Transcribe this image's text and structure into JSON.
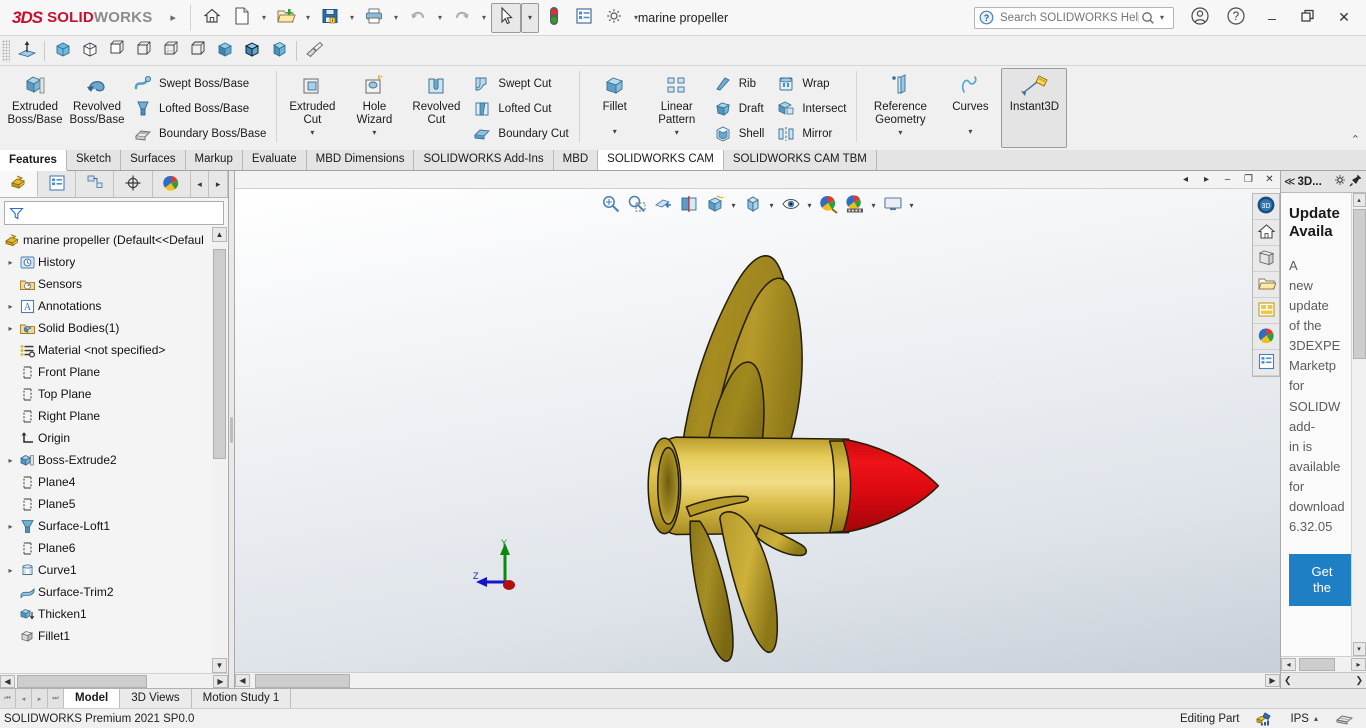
{
  "titlebar": {
    "logo_ds": "3DS",
    "logo_solid": "SOLID",
    "logo_works": "WORKS",
    "expand_label": "▸",
    "document_title": "marine propeller",
    "buttons": [
      {
        "name": "home-icon",
        "label": "Home"
      },
      {
        "name": "new-document-icon",
        "label": "New"
      },
      {
        "name": "open-document-icon",
        "label": "Open"
      },
      {
        "name": "save-icon",
        "label": "Save"
      },
      {
        "name": "print-icon",
        "label": "Print"
      },
      {
        "name": "undo-icon",
        "label": "Undo"
      },
      {
        "name": "redo-icon",
        "label": "Redo"
      },
      {
        "name": "select-cursor-icon",
        "label": "Select"
      },
      {
        "name": "rebuild-icon",
        "label": "Rebuild"
      },
      {
        "name": "options-list-icon",
        "label": "File Properties"
      },
      {
        "name": "gear-icon",
        "label": "Options"
      }
    ],
    "search_placeholder": "Search SOLIDWORKS Help",
    "search_value": "",
    "account_label": "Account",
    "help_label": "Help",
    "minimize_label": "–",
    "restore_label": "❐",
    "close_label": "✕"
  },
  "reference_toolbar": {
    "items": [
      {
        "name": "reference-plane-icon",
        "label": "Plane"
      },
      {
        "name": "iso-view-icon",
        "label": "Isometric"
      },
      {
        "name": "trimetric-view-icon",
        "label": "Trimetric"
      },
      {
        "name": "dimetric-view-icon",
        "label": "Dimetric"
      },
      {
        "name": "wireframe-box-icon",
        "label": "Wireframe"
      },
      {
        "name": "hidden-lines-box-icon",
        "label": "Hidden Lines Visible"
      },
      {
        "name": "hidden-removed-box-icon",
        "label": "Hidden Lines Removed"
      },
      {
        "name": "shaded-box-icon",
        "label": "Shaded"
      },
      {
        "name": "shaded-edges-box-icon",
        "label": "Shaded With Edges"
      },
      {
        "name": "perspective-box-icon",
        "label": "Perspective"
      },
      {
        "name": "section-view-icon",
        "label": "Section View"
      }
    ]
  },
  "ribbon": {
    "groups": [
      {
        "name": "boss-base-group",
        "big": [
          {
            "name": "extruded-boss-base-button",
            "icon": "extrude-boss-icon",
            "line1": "Extruded",
            "line2": "Boss/Base"
          },
          {
            "name": "revolved-boss-base-button",
            "icon": "revolve-boss-icon",
            "line1": "Revolved",
            "line2": "Boss/Base"
          }
        ],
        "small": [
          {
            "name": "swept-boss-base-button",
            "icon": "swept-boss-icon",
            "label": "Swept Boss/Base"
          },
          {
            "name": "lofted-boss-base-button",
            "icon": "lofted-boss-icon",
            "label": "Lofted Boss/Base"
          },
          {
            "name": "boundary-boss-base-button",
            "icon": "boundary-boss-icon",
            "label": "Boundary Boss/Base"
          }
        ]
      },
      {
        "name": "cut-group",
        "big": [
          {
            "name": "extruded-cut-button",
            "icon": "extrude-cut-icon",
            "line1": "Extruded",
            "line2": "Cut",
            "dropdown": true
          },
          {
            "name": "hole-wizard-button",
            "icon": "hole-wizard-icon",
            "line1": "Hole",
            "line2": "Wizard",
            "dropdown": true
          },
          {
            "name": "revolved-cut-button",
            "icon": "revolve-cut-icon",
            "line1": "Revolved",
            "line2": "Cut"
          }
        ],
        "small": [
          {
            "name": "swept-cut-button",
            "icon": "swept-cut-icon",
            "label": "Swept Cut"
          },
          {
            "name": "lofted-cut-button",
            "icon": "lofted-cut-icon",
            "label": "Lofted Cut"
          },
          {
            "name": "boundary-cut-button",
            "icon": "boundary-cut-icon",
            "label": "Boundary Cut"
          }
        ]
      },
      {
        "name": "feature-group",
        "big": [
          {
            "name": "fillet-button",
            "icon": "fillet-icon",
            "line1": "Fillet",
            "line2": "",
            "dropdown": true
          },
          {
            "name": "linear-pattern-button",
            "icon": "linear-pattern-icon",
            "line1": "Linear",
            "line2": "Pattern",
            "dropdown": true
          }
        ],
        "small": [
          {
            "name": "rib-button",
            "icon": "rib-icon",
            "label": "Rib"
          },
          {
            "name": "draft-button",
            "icon": "draft-icon",
            "label": "Draft"
          },
          {
            "name": "shell-button",
            "icon": "shell-icon",
            "label": "Shell"
          }
        ],
        "small2": [
          {
            "name": "wrap-button",
            "icon": "wrap-icon",
            "label": "Wrap"
          },
          {
            "name": "intersect-button",
            "icon": "intersect-icon",
            "label": "Intersect"
          },
          {
            "name": "mirror-button",
            "icon": "mirror-icon",
            "label": "Mirror"
          }
        ]
      },
      {
        "name": "geometry-group",
        "big": [
          {
            "name": "reference-geometry-button",
            "icon": "reference-geometry-icon",
            "line1": "Reference",
            "line2": "Geometry",
            "dropdown": true
          },
          {
            "name": "curves-button",
            "icon": "curves-icon",
            "line1": "Curves",
            "line2": "",
            "dropdown": true
          },
          {
            "name": "instant3d-button",
            "icon": "instant3d-icon",
            "line1": "Instant3D",
            "line2": "",
            "active": true
          }
        ]
      }
    ],
    "collapse_label": "⌃"
  },
  "tabs": [
    {
      "name": "tab-features",
      "label": "Features",
      "state": "active"
    },
    {
      "name": "tab-sketch",
      "label": "Sketch",
      "state": ""
    },
    {
      "name": "tab-surfaces",
      "label": "Surfaces",
      "state": ""
    },
    {
      "name": "tab-markup",
      "label": "Markup",
      "state": ""
    },
    {
      "name": "tab-evaluate",
      "label": "Evaluate",
      "state": ""
    },
    {
      "name": "tab-mbd-dimensions",
      "label": "MBD Dimensions",
      "state": ""
    },
    {
      "name": "tab-solidworks-addins",
      "label": "SOLIDWORKS Add-Ins",
      "state": ""
    },
    {
      "name": "tab-mbd",
      "label": "MBD",
      "state": ""
    },
    {
      "name": "tab-solidworks-cam",
      "label": "SOLIDWORKS CAM",
      "state": "active2"
    },
    {
      "name": "tab-solidworks-cam-tbm",
      "label": "SOLIDWORKS CAM TBM",
      "state": ""
    }
  ],
  "feature_manager": {
    "tabs": [
      {
        "name": "fm-tab-feature-tree",
        "icon": "feature-tree-icon",
        "active": true
      },
      {
        "name": "fm-tab-property-manager",
        "icon": "property-manager-icon",
        "active": false
      },
      {
        "name": "fm-tab-configuration-manager",
        "icon": "configuration-manager-icon",
        "active": false
      },
      {
        "name": "fm-tab-dimxpert-manager",
        "icon": "dimxpert-icon",
        "active": false
      },
      {
        "name": "fm-tab-display-manager",
        "icon": "display-manager-icon",
        "active": false
      }
    ],
    "nav_prev": "◂",
    "nav_next": "▸",
    "filter_placeholder": "",
    "filter_value": "",
    "filter_icon": "filter-funnel-icon",
    "root": {
      "name": "tree-root",
      "icon": "part-icon",
      "label": "marine propeller  (Default<<Defaul"
    },
    "items": [
      {
        "name": "tree-item-history",
        "icon": "history-icon",
        "label": "History",
        "expandable": true,
        "indent": 0
      },
      {
        "name": "tree-item-sensors",
        "icon": "sensors-icon",
        "label": "Sensors",
        "expandable": false,
        "indent": 0
      },
      {
        "name": "tree-item-annotations",
        "icon": "annotations-icon",
        "label": "Annotations",
        "expandable": true,
        "indent": 0
      },
      {
        "name": "tree-item-solid-bodies",
        "icon": "solid-bodies-icon",
        "label": "Solid Bodies(1)",
        "expandable": true,
        "indent": 0
      },
      {
        "name": "tree-item-material",
        "icon": "material-icon",
        "label": "Material <not specified>",
        "expandable": false,
        "indent": 0
      },
      {
        "name": "tree-item-front-plane",
        "icon": "plane-icon",
        "label": "Front Plane",
        "expandable": false,
        "indent": 0
      },
      {
        "name": "tree-item-top-plane",
        "icon": "plane-icon",
        "label": "Top Plane",
        "expandable": false,
        "indent": 0
      },
      {
        "name": "tree-item-right-plane",
        "icon": "plane-icon",
        "label": "Right Plane",
        "expandable": false,
        "indent": 0
      },
      {
        "name": "tree-item-origin",
        "icon": "origin-icon",
        "label": "Origin",
        "expandable": false,
        "indent": 0
      },
      {
        "name": "tree-item-boss-extrude2",
        "icon": "boss-extrude-icon",
        "label": "Boss-Extrude2",
        "expandable": true,
        "indent": 0
      },
      {
        "name": "tree-item-plane4",
        "icon": "plane-icon",
        "label": "Plane4",
        "expandable": false,
        "indent": 0
      },
      {
        "name": "tree-item-plane5",
        "icon": "plane-icon",
        "label": "Plane5",
        "expandable": false,
        "indent": 0
      },
      {
        "name": "tree-item-surface-loft1",
        "icon": "surface-loft-icon",
        "label": "Surface-Loft1",
        "expandable": true,
        "indent": 0
      },
      {
        "name": "tree-item-plane6",
        "icon": "plane-icon",
        "label": "Plane6",
        "expandable": false,
        "indent": 0
      },
      {
        "name": "tree-item-curve1",
        "icon": "curve-icon",
        "label": "Curve1",
        "expandable": true,
        "indent": 0
      },
      {
        "name": "tree-item-surface-trim2",
        "icon": "surface-trim-icon",
        "label": "Surface-Trim2",
        "expandable": false,
        "indent": 0
      },
      {
        "name": "tree-item-thicken1",
        "icon": "thicken-icon",
        "label": "Thicken1",
        "expandable": false,
        "indent": 0
      },
      {
        "name": "tree-item-fillet1",
        "icon": "fillet-tree-icon",
        "label": "Fillet1",
        "expandable": false,
        "indent": 0
      }
    ]
  },
  "viewport": {
    "header_buttons": [
      {
        "name": "viewport-prev-button",
        "label": "◂"
      },
      {
        "name": "viewport-next-button",
        "label": "▸"
      },
      {
        "name": "viewport-minimize-button",
        "label": "–"
      },
      {
        "name": "viewport-restore-button",
        "label": "❐"
      },
      {
        "name": "viewport-close-button",
        "label": "✕"
      }
    ],
    "toolbar": [
      {
        "name": "zoom-to-fit-button",
        "icon": "zoom-to-fit-icon",
        "caret": false
      },
      {
        "name": "zoom-to-area-button",
        "icon": "zoom-to-area-icon",
        "caret": false
      },
      {
        "name": "previous-view-button",
        "icon": "previous-view-icon",
        "caret": false
      },
      {
        "name": "section-view-button",
        "icon": "section-view-icon",
        "caret": false
      },
      {
        "name": "view-orientation-button",
        "icon": "view-orientation-icon",
        "caret": false
      },
      {
        "name": "display-style-button",
        "icon": "display-style-icon",
        "caret": true
      },
      {
        "name": "hide-show-items-button",
        "icon": "hide-show-items-icon",
        "caret": true
      },
      {
        "name": "edit-appearance-button",
        "icon": "edit-appearance-icon",
        "caret": true
      },
      {
        "name": "apply-scene-button",
        "icon": "apply-scene-icon",
        "caret": false
      },
      {
        "name": "view-settings-button",
        "icon": "view-settings-icon",
        "caret": true
      },
      {
        "name": "viewport-layout-button",
        "icon": "viewport-layout-icon",
        "caret": true
      }
    ],
    "triad": {
      "x_label": "",
      "y_label": "Y",
      "z_label": "Z",
      "x_color": "#c00000",
      "y_color": "#008000",
      "z_color": "#0000c0"
    },
    "model": {
      "name": "marine-propeller-model",
      "blade_color": "#a88c1e",
      "hub_color": "#d9bd43",
      "nose_cone_color": "#dc0a12",
      "edge_color": "#2a2208"
    },
    "right_strip": [
      {
        "name": "3dexperience-icon"
      },
      {
        "name": "home-panel-icon"
      },
      {
        "name": "design-library-icon"
      },
      {
        "name": "file-explorer-icon"
      },
      {
        "name": "view-palette-icon"
      },
      {
        "name": "appearances-scenes-icon"
      },
      {
        "name": "custom-properties-icon"
      }
    ]
  },
  "task_pane": {
    "collapse_label": "≪",
    "title": "3D...",
    "gear_icon": "gear-icon",
    "pin_icon": "pin-icon",
    "heading": "Update Available",
    "body_lines": [
      "A",
      "new",
      "update",
      "of the",
      "3DEXPE",
      "Marketp",
      "for",
      "SOLIDW",
      "add-",
      "in is",
      "available",
      "for",
      "download",
      "6.32.05"
    ],
    "button_line1": "Get",
    "button_line2": "the",
    "scroll_up": "▴",
    "scroll_down": "▾",
    "scroll_left": "◂",
    "scroll_right": "▸"
  },
  "bottom_tabs": {
    "nav": [
      "⏮",
      "◂",
      "▸",
      "⏭"
    ],
    "items": [
      {
        "name": "bottom-tab-model",
        "label": "Model",
        "active": true
      },
      {
        "name": "bottom-tab-3d-views",
        "label": "3D Views",
        "active": false
      },
      {
        "name": "bottom-tab-motion-study",
        "label": "Motion Study 1",
        "active": false
      }
    ]
  },
  "status_bar": {
    "version": "SOLIDWORKS Premium 2021 SP0.0",
    "editing_state": "Editing Part",
    "editing_icon": "editing-part-icon",
    "units": "IPS",
    "units_caret": "▴",
    "overlay_icon": "tangent-edges-icon"
  }
}
